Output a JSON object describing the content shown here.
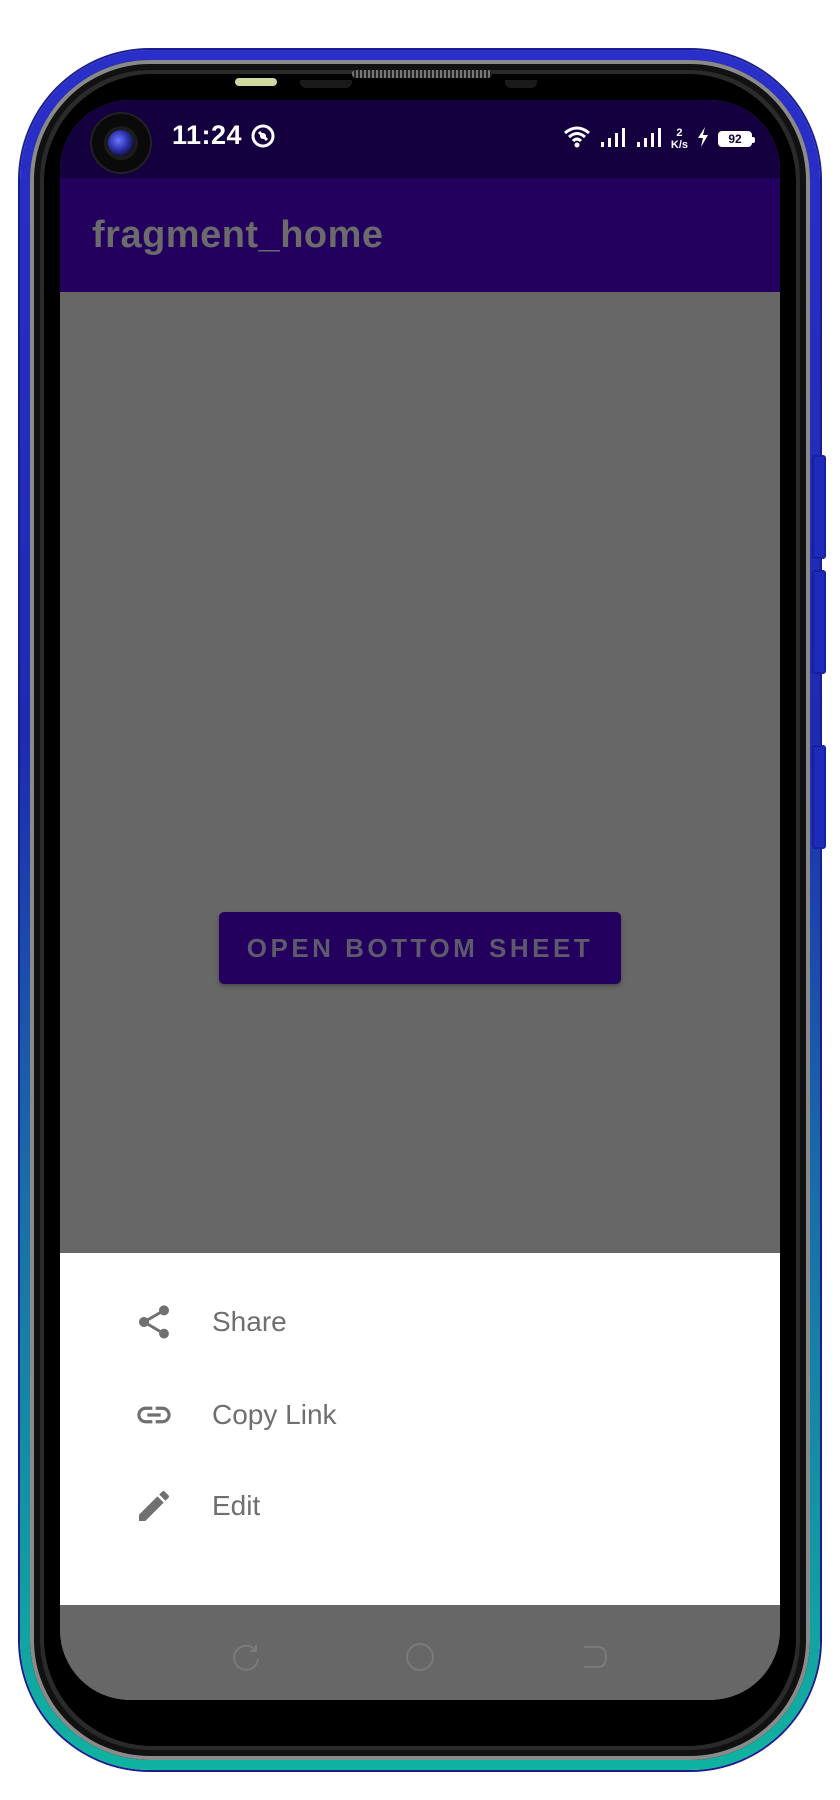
{
  "status_bar": {
    "time": "11:24",
    "speed_value": "2",
    "speed_unit": "K/s",
    "battery": "92",
    "icons": [
      "wifi-icon",
      "signal-1-icon",
      "signal-2-icon",
      "charging-icon"
    ]
  },
  "app_bar": {
    "title": "fragment_home"
  },
  "main": {
    "open_button_label": "OPEN BOTTOM SHEET"
  },
  "bottom_sheet": {
    "items": [
      {
        "label": "Share",
        "icon": "share-icon"
      },
      {
        "label": "Copy Link",
        "icon": "link-icon"
      },
      {
        "label": "Edit",
        "icon": "pencil-icon"
      }
    ]
  },
  "colors": {
    "status_bar": "#14003e",
    "app_bar": "#23005e",
    "scrim": "#676767",
    "sheet_background": "#ffffff",
    "sheet_text": "#6f6f6f"
  }
}
